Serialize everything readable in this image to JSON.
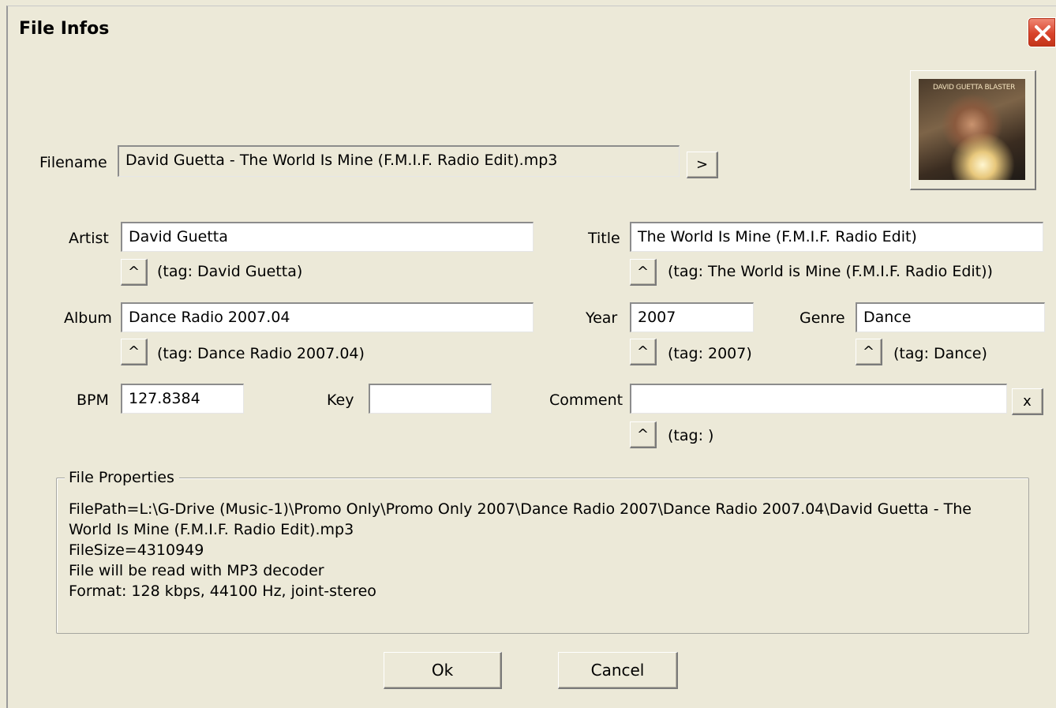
{
  "window": {
    "title": "File Infos",
    "close_icon": "close-icon"
  },
  "filename": {
    "label": "Filename",
    "value": "David Guetta - The World Is Mine (F.M.I.F. Radio Edit).mp3",
    "browse_label": ">"
  },
  "album_art": {
    "caption": "DAVID GUETTA BLASTER"
  },
  "artist": {
    "label": "Artist",
    "value": "David Guetta",
    "copy_label": "^",
    "tag": "(tag: David Guetta)"
  },
  "title_field": {
    "label": "Title",
    "value": "The World Is Mine (F.M.I.F. Radio Edit)",
    "copy_label": "^",
    "tag": "(tag: The World is Mine (F.M.I.F. Radio Edit))"
  },
  "album": {
    "label": "Album",
    "value": "Dance Radio 2007.04",
    "copy_label": "^",
    "tag": "(tag: Dance Radio 2007.04)"
  },
  "year": {
    "label": "Year",
    "value": "2007",
    "copy_label": "^",
    "tag": "(tag: 2007)"
  },
  "genre": {
    "label": "Genre",
    "value": "Dance",
    "copy_label": "^",
    "tag": "(tag: Dance)"
  },
  "bpm": {
    "label": "BPM",
    "value": "127.8384"
  },
  "key": {
    "label": "Key",
    "value": ""
  },
  "comment": {
    "label": "Comment",
    "value": "",
    "clear_label": "x",
    "copy_label": "^",
    "tag": "(tag: )"
  },
  "file_properties": {
    "title": "File Properties",
    "lines": [
      "FilePath=L:\\G-Drive (Music-1)\\Promo Only\\Promo Only 2007\\Dance Radio 2007\\Dance Radio 2007.04\\David Guetta - The World Is Mine (F.M.I.F. Radio Edit).mp3",
      "FileSize=4310949",
      "File will be read with MP3 decoder",
      "Format: 128 kbps, 44100 Hz, joint-stereo"
    ]
  },
  "buttons": {
    "ok": "Ok",
    "cancel": "Cancel"
  },
  "colors": {
    "dialog_bg": "#ece9d8",
    "close_red": "#d8432b"
  }
}
